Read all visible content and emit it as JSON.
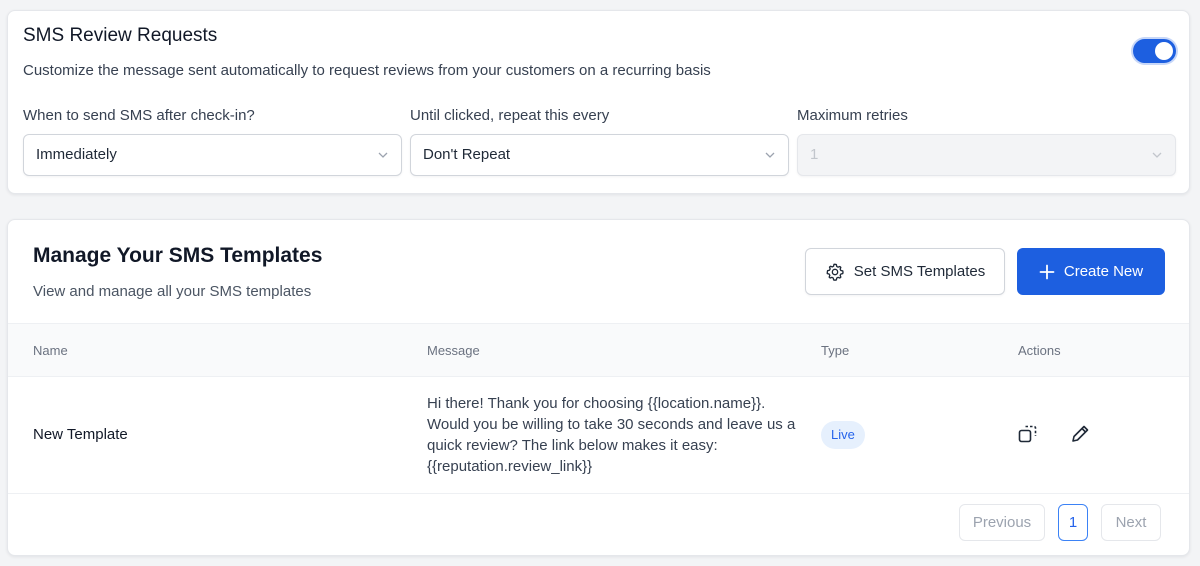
{
  "sms_review": {
    "title": "SMS Review Requests",
    "description": "Customize the message sent automatically to request reviews from your customers on a recurring basis",
    "enabled": true,
    "fields": [
      {
        "label": "When to send SMS after check-in?",
        "value": "Immediately",
        "disabled": false
      },
      {
        "label": "Until clicked, repeat this every",
        "value": "Don't Repeat",
        "disabled": false
      },
      {
        "label": "Maximum retries",
        "value": "1",
        "disabled": true
      }
    ]
  },
  "templates": {
    "title": "Manage Your SMS Templates",
    "description": "View and manage all your SMS templates",
    "set_button": "Set SMS Templates",
    "create_button": "Create New",
    "columns": [
      "Name",
      "Message",
      "Type",
      "Actions"
    ],
    "rows": [
      {
        "name": "New Template",
        "message": "Hi there! Thank you for choosing {{location.name}}. Would you be willing to take 30 seconds and leave us a quick review? The link below makes it easy: {{reputation.review_link}}",
        "type": "Live"
      }
    ],
    "pagination": {
      "previous": "Previous",
      "current_page": "1",
      "next": "Next"
    }
  },
  "colors": {
    "primary": "#1d5fe0",
    "badge_bg": "#e6f0fd",
    "badge_text": "#2563eb"
  }
}
